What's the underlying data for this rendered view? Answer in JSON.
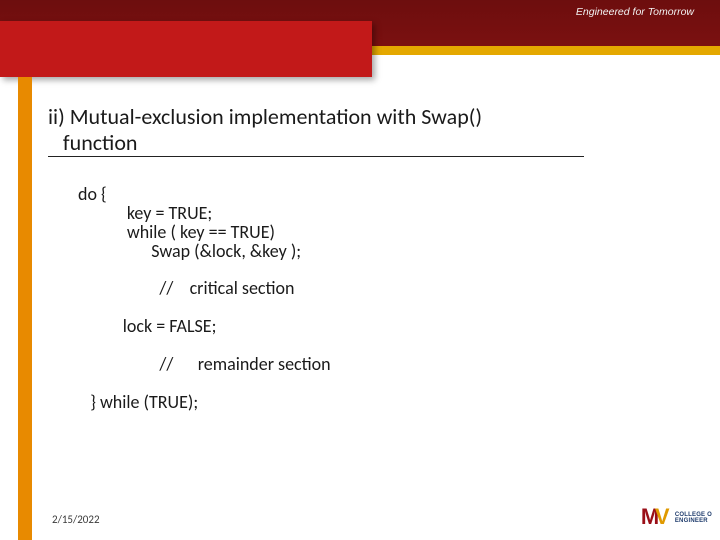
{
  "header": {
    "tagline": "Engineered for Tomorrow"
  },
  "title": {
    "line1": "ii) Mutual-exclusion implementation with Swap()",
    "line2": "function"
  },
  "code": {
    "l1": "do {",
    "l2": "            key = TRUE;",
    "l3": "            while ( key == TRUE)",
    "l4": "                  Swap (&lock, &key );",
    "l5": "                    //    critical section",
    "l6": "           lock = FALSE;",
    "l7": "                    //      remainder section",
    "l8": "   } while (TRUE);"
  },
  "footer": {
    "date": "2/15/2022",
    "logo_top": "COLLEGE O",
    "logo_bot": "ENGINEER"
  }
}
